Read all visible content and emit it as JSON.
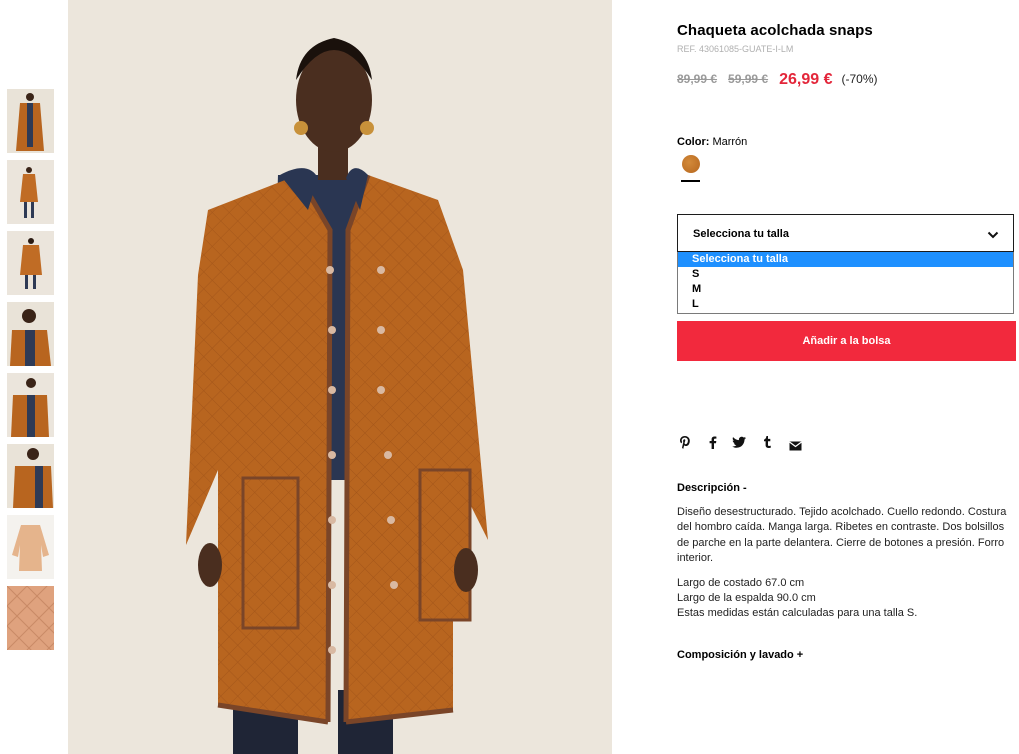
{
  "thumbnails": [
    {
      "alt": "Vista frontal"
    },
    {
      "alt": "Vista completa"
    },
    {
      "alt": "Vista trasera"
    },
    {
      "alt": "Detalle cuello"
    },
    {
      "alt": "Detalle manga"
    },
    {
      "alt": "Detalle lateral"
    },
    {
      "alt": "Prenda plana"
    },
    {
      "alt": "Detalle tejido"
    }
  ],
  "product": {
    "title": "Chaqueta acolchada snaps",
    "ref": "REF. 43061085-GUATE-I-LM",
    "price_old_1": "89,99 €",
    "price_old_2": "59,99 €",
    "price_new": "26,99 €",
    "discount": "(-70%)"
  },
  "color": {
    "label": "Color:",
    "value": "Marrón",
    "swatch_hex": "#c77a2e"
  },
  "size_select": {
    "label": "Selecciona tu talla",
    "options": [
      "Selecciona tu talla",
      "S",
      "M",
      "L"
    ],
    "selected_index": 0
  },
  "add_to_bag": "Añadir a la bolsa",
  "share_icons": [
    "pinterest-icon",
    "facebook-icon",
    "twitter-icon",
    "tumblr-icon",
    "email-icon"
  ],
  "description": {
    "title": "Descripción -",
    "paragraph": "Diseño desestructurado. Tejido acolchado. Cuello redondo. Costura del hombro caída. Manga larga. Ribetes en contraste. Dos bolsillos de parche en la parte delantera. Cierre de botones a presión. Forro interior.",
    "measure_1": "Largo de costado 67.0 cm",
    "measure_2": "Largo de la espalda 90.0 cm",
    "measure_3": "Estas medidas están calculadas para una talla S."
  },
  "composition_title": "Composición y lavado +",
  "colors": {
    "accent_red": "#f2293d",
    "price_red": "#e3263a",
    "select_highlight": "#1e90ff",
    "coat_orange": "#b8651f"
  }
}
